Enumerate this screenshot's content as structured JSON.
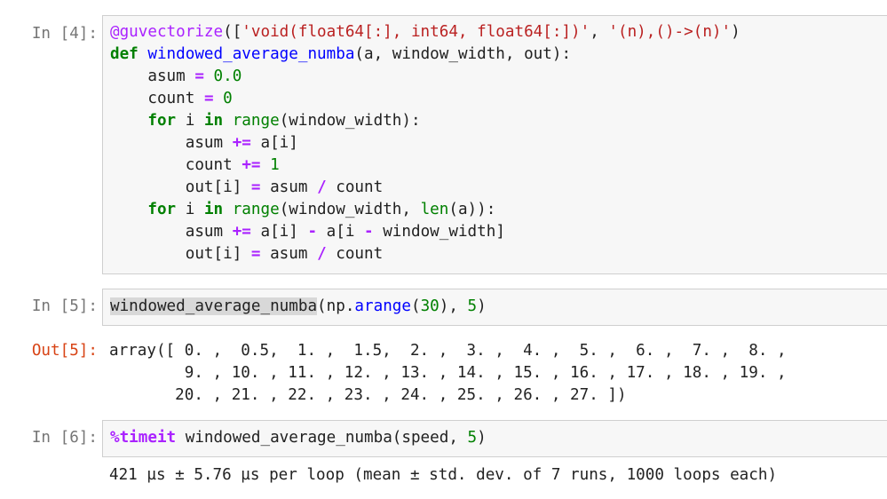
{
  "cells": [
    {
      "prompt": "In [4]:",
      "code": {
        "line1": {
          "decorator": "@guvectorize",
          "open": "([",
          "sig": "'void(float64[:], int64, float64[:])'",
          "comma": ", ",
          "layout": "'(n),()->(n)'",
          "close": ")"
        },
        "line2": {
          "kw": "def",
          "name": "windowed_average_numba",
          "args": "(a, window_width, out):"
        },
        "line3": {
          "indent": "    ",
          "var": "asum",
          "op": "=",
          "val": "0.0"
        },
        "line4": {
          "indent": "    ",
          "var": "count",
          "op": "=",
          "val": "0"
        },
        "line5": {
          "indent": "    ",
          "kw_for": "for",
          "mid": " i ",
          "kw_in": "in",
          "fn": "range",
          "rest": "(window_width):"
        },
        "line6": {
          "indent": "        ",
          "lhs": "asum",
          "op": "+=",
          "rhs": "a[i]"
        },
        "line7": {
          "indent": "        ",
          "lhs": "count",
          "op": "+=",
          "rhs": "1"
        },
        "line8": {
          "indent": "        ",
          "lhs": "out[i]",
          "op": "=",
          "a": "asum",
          "op2": "/",
          "b": "count"
        },
        "line9": {
          "indent": "    ",
          "kw_for": "for",
          "mid": " i ",
          "kw_in": "in",
          "fn": "range",
          "a": "(window_width, ",
          "fn2": "len",
          "b": "(a)):"
        },
        "line10": {
          "indent": "        ",
          "lhs": "asum",
          "op": "+=",
          "a": "a[i]",
          "op2": "-",
          "b": "a[i",
          "op3": "-",
          "c": "window_width]"
        },
        "line11": {
          "indent": "        ",
          "lhs": "out[i]",
          "op": "=",
          "a": "asum",
          "op2": "/",
          "b": "count"
        }
      }
    },
    {
      "prompt": "In [5]:",
      "code": {
        "fn": "windowed_average_numba",
        "a": "(np.",
        "attr": "arange",
        "b": "(",
        "n1": "30",
        "c": "), ",
        "n2": "5",
        "d": ")"
      },
      "out_prompt": "Out[5]:",
      "output": [
        "array([ 0. ,  0.5,  1. ,  1.5,  2. ,  3. ,  4. ,  5. ,  6. ,  7. ,  8. ,",
        "        9. , 10. , 11. , 12. , 13. , 14. , 15. , 16. , 17. , 18. , 19. ,",
        "       20. , 21. , 22. , 23. , 24. , 25. , 26. , 27. ])"
      ]
    },
    {
      "prompt": "In [6]:",
      "code": {
        "magic": "%timeit",
        "rest": " windowed_average_numba(speed, ",
        "n": "5",
        "end": ")"
      },
      "output": "421 µs ± 5.76 µs per loop (mean ± std. dev. of 7 runs, 1000 loops each)"
    }
  ]
}
